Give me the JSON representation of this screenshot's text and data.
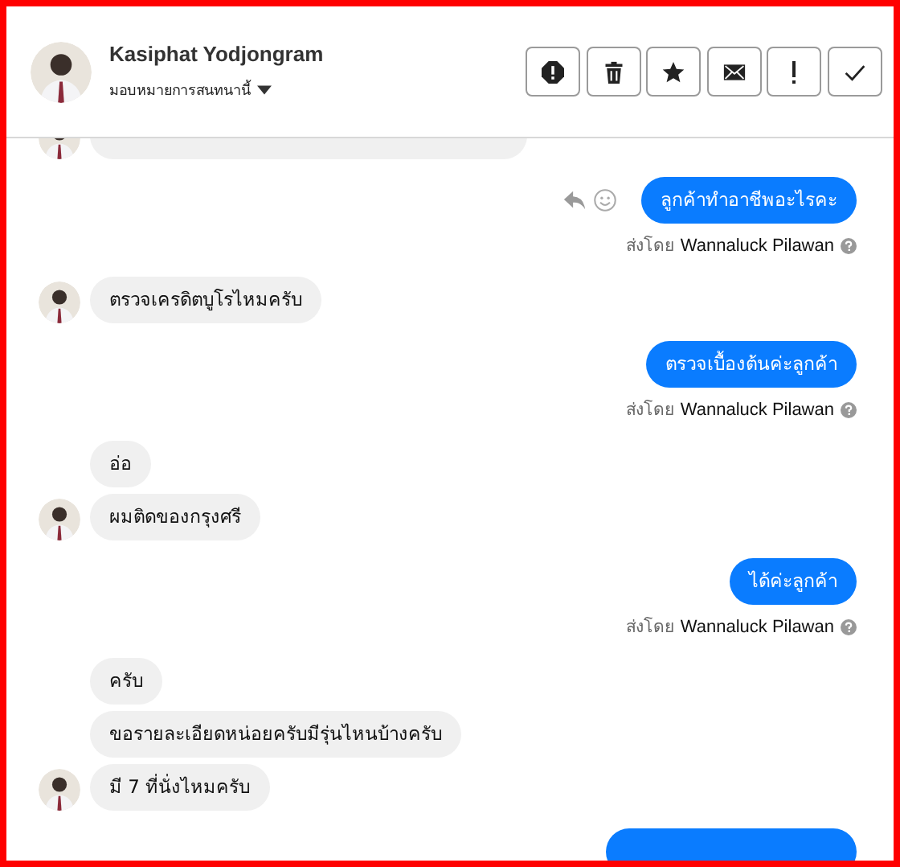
{
  "header": {
    "name": "Kasiphat Yodjongram",
    "assign_label": "มอบหมายการสนทนานี้",
    "buttons": [
      {
        "kind": "alert"
      },
      {
        "kind": "trash"
      },
      {
        "kind": "star"
      },
      {
        "kind": "mail"
      },
      {
        "kind": "exclaim"
      },
      {
        "kind": "check"
      }
    ]
  },
  "groups": [
    {
      "kind": "clipped_incoming"
    },
    {
      "kind": "outgoing",
      "actions": true,
      "sender_prefix": "ส่งโดย",
      "sender": "Wannaluck Pilawan",
      "messages": [
        {
          "text": "ลูกค้าทำอาชีพอะไรคะ"
        }
      ]
    },
    {
      "kind": "incoming",
      "messages": [
        {
          "text": "ตรวจเครดิตบูโรไหมครับ",
          "avatar": true
        }
      ]
    },
    {
      "kind": "outgoing",
      "actions": false,
      "sender_prefix": "ส่งโดย",
      "sender": "Wannaluck Pilawan",
      "messages": [
        {
          "text": "ตรวจเบื้องต้นค่ะลูกค้า"
        }
      ]
    },
    {
      "kind": "incoming",
      "messages": [
        {
          "text": "อ่อ",
          "avatar": false
        },
        {
          "text": "ผมติดของกรุงศรี",
          "avatar": true
        }
      ]
    },
    {
      "kind": "outgoing",
      "actions": false,
      "sender_prefix": "ส่งโดย",
      "sender": "Wannaluck Pilawan",
      "messages": [
        {
          "text": "ได้ค่ะลูกค้า"
        }
      ]
    },
    {
      "kind": "incoming",
      "messages": [
        {
          "text": "ครับ",
          "avatar": false
        },
        {
          "text": "ขอรายละเอียดหน่อยครับมีรุ่นไหนบ้างครับ",
          "avatar": false
        },
        {
          "text": "มี 7 ที่นั่งไหมครับ",
          "avatar": true
        }
      ]
    },
    {
      "kind": "clipped_outgoing"
    }
  ]
}
